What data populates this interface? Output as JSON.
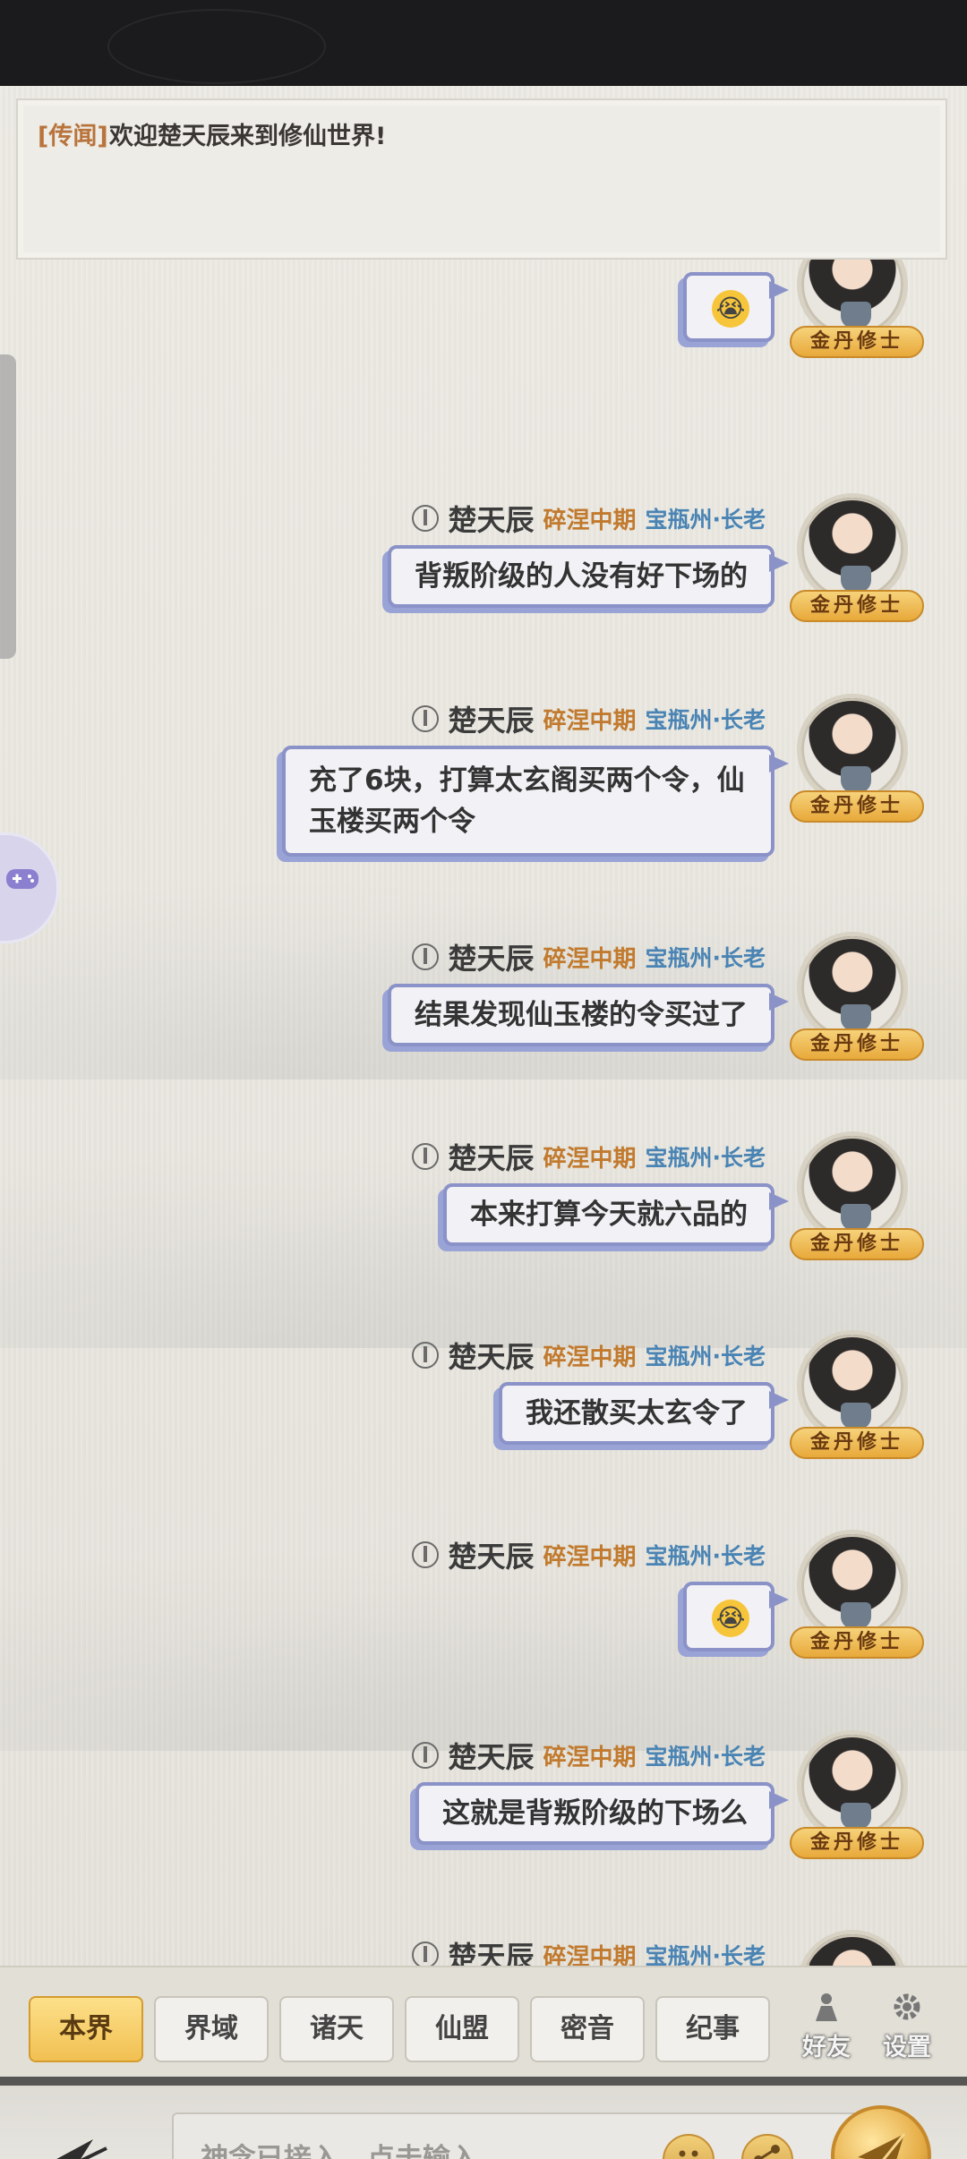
{
  "announcement": {
    "tag": "[传闻]",
    "text": "欢迎楚天辰来到修仙世界!"
  },
  "sender": {
    "name": "楚天辰",
    "realm": "碎涅中期",
    "title": "宝瓶州·长老",
    "rank_badge": "金丹修士"
  },
  "messages": [
    {
      "text": "😭",
      "type": "emoji"
    },
    {
      "text": "背叛阶级的人没有好下场的",
      "type": "text"
    },
    {
      "text": "充了6块，打算太玄阁买两个令，仙玉楼买两个令",
      "type": "text"
    },
    {
      "text": "结果发现仙玉楼的令买过了",
      "type": "text"
    },
    {
      "text": "本来打算今天就六品的",
      "type": "text"
    },
    {
      "text": "我还散买太玄令了",
      "type": "text"
    },
    {
      "text": "😭",
      "type": "emoji"
    },
    {
      "text": "这就是背叛阶级的下场么",
      "type": "text"
    }
  ],
  "tabs": [
    "本界",
    "界域",
    "诸天",
    "仙盟",
    "密音",
    "纪事"
  ],
  "tab_icons": {
    "friends": "好友",
    "settings": "设置"
  },
  "input": {
    "placeholder": "神念已接入，点击输入"
  },
  "icons": [
    "back-arrow-icon",
    "smiley-icon",
    "share-icon",
    "send-icon",
    "gamepad-icon",
    "friends-icon",
    "gear-icon"
  ]
}
